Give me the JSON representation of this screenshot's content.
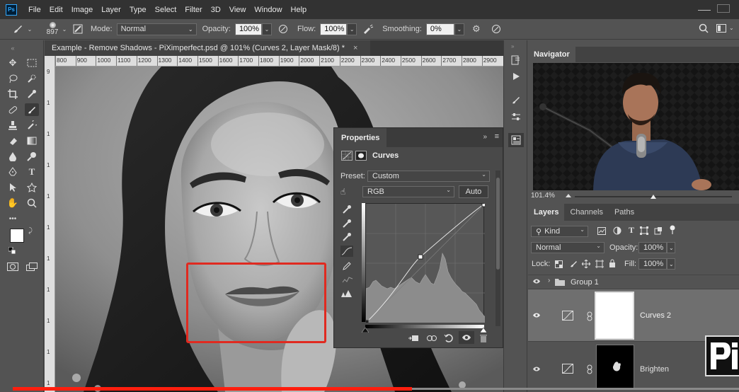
{
  "menubar": {
    "logo": "Ps",
    "items": [
      "File",
      "Edit",
      "Image",
      "Layer",
      "Type",
      "Select",
      "Filter",
      "3D",
      "View",
      "Window",
      "Help"
    ]
  },
  "options": {
    "brush_size": "897",
    "mode_label": "Mode:",
    "mode_value": "Normal",
    "opacity_label": "Opacity:",
    "opacity_value": "100%",
    "flow_label": "Flow:",
    "flow_value": "100%",
    "smoothing_label": "Smoothing:",
    "smoothing_value": "0%"
  },
  "document": {
    "tab_title": "Example - Remove Shadows - PiXimperfect.psd @ 101% (Curves 2, Layer Mask/8) *",
    "close": "×",
    "ruler_ticks": [
      "800",
      "900",
      "1000",
      "1100",
      "1200",
      "1300",
      "1400",
      "1500",
      "1600",
      "1700",
      "1800",
      "1900",
      "2000",
      "2100",
      "2200",
      "2300",
      "2400",
      "2500",
      "2600",
      "2700",
      "2800",
      "2900"
    ],
    "vruler_ticks": [
      "9",
      "1",
      "1",
      "1",
      "1",
      "1",
      "1",
      "1",
      "1",
      "1",
      "1"
    ]
  },
  "properties": {
    "tab_label": "Properties",
    "adjustment_title": "Curves",
    "preset_label": "Preset:",
    "preset_value": "Custom",
    "channel_value": "RGB",
    "auto_label": "Auto"
  },
  "navigator": {
    "tab_label": "Navigator",
    "zoom_value": "101.4%"
  },
  "layers": {
    "tabs": [
      "Layers",
      "Channels",
      "Paths"
    ],
    "filter_kind": "Kind",
    "blend_mode": "Normal",
    "opacity_label": "Opacity:",
    "opacity_value": "100%",
    "lock_label": "Lock:",
    "fill_label": "Fill:",
    "fill_value": "100%",
    "rows": [
      {
        "name": "Group 1"
      },
      {
        "name": "Curves 2"
      },
      {
        "name": "Brighten"
      }
    ]
  },
  "video": {
    "progress_fraction": 0.55
  },
  "colors": {
    "selection_outline": "#e02a20",
    "progress_fill": "#ff1e0e",
    "ps_blue": "#31a8ff"
  }
}
